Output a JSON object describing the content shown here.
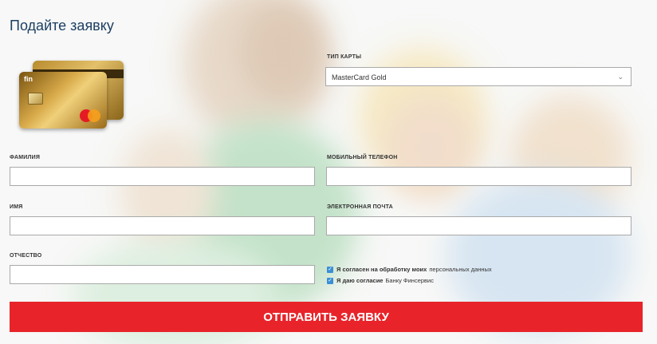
{
  "page": {
    "title": "Подайте заявку"
  },
  "card_image": {
    "logo": "fin",
    "brand": "MasterCard"
  },
  "form": {
    "card_type": {
      "label": "ТИП КАРТЫ",
      "value": "MasterCard Gold"
    },
    "last_name": {
      "label": "ФАМИЛИЯ",
      "value": ""
    },
    "phone": {
      "label": "МОБИЛЬНЫЙ ТЕЛЕФОН",
      "value": ""
    },
    "first_name": {
      "label": "ИМЯ",
      "value": ""
    },
    "email": {
      "label": "ЭЛЕКТРОННАЯ ПОЧТА",
      "value": ""
    },
    "middle_name": {
      "label": "ОТЧЕСТВО",
      "value": ""
    },
    "consent1": {
      "bold": "Я согласен на обработку моих",
      "rest": "персональных данных",
      "checked": true
    },
    "consent2": {
      "bold": "Я даю согласие",
      "rest": "Банку Финсервис",
      "checked": true
    },
    "submit_label": "ОТПРАВИТЬ ЗАЯВКУ"
  },
  "colors": {
    "accent": "#e8242a",
    "title": "#1d3f63",
    "checkbox": "#3a8fd6"
  }
}
